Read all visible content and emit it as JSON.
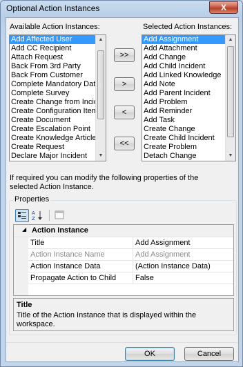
{
  "window": {
    "title": "Optional Action Instances",
    "close_glyph": "X"
  },
  "available": {
    "label": "Available Action Instances:",
    "items": [
      "Add Affected User",
      "Add CC Recipient",
      "Attach Request",
      "Back From 3rd Party",
      "Back From Customer",
      "Complete Mandatory Data",
      "Complete Survey",
      "Create Change from Incident",
      "Create Configuration Item",
      "Create Document",
      "Create Escalation Point",
      "Create Knowledge Article",
      "Create Request",
      "Declare Major Incident"
    ],
    "selected_index": 0
  },
  "selected": {
    "label": "Selected Action Instances:",
    "items": [
      "Add Assignment",
      "Add Attachment",
      "Add Change",
      "Add Child Incident",
      "Add Linked Knowledge",
      "Add Note",
      "Add Parent Incident",
      "Add Problem",
      "Add Reminder",
      "Add Task",
      "Create Change",
      "Create Child Incident",
      "Create Problem",
      "Detach Change"
    ],
    "selected_index": 0
  },
  "move_buttons": {
    "add_all": ">>",
    "add": ">",
    "remove": "<",
    "remove_all": "<<"
  },
  "info_text_line1": "If required you can modify the following properties of the",
  "info_text_line2": "selected Action Instance.",
  "properties": {
    "group_label": "Properties",
    "category_expander": "◢",
    "category": "Action Instance",
    "rows": [
      {
        "name": "Title",
        "value": "Add Assignment",
        "disabled": false
      },
      {
        "name": "Action Instance Name",
        "value": "Add Assignment",
        "disabled": true
      },
      {
        "name": "Action Instance Data",
        "value": "(Action Instance Data)",
        "disabled": false
      },
      {
        "name": "Propagate Action to Child",
        "value": "False",
        "disabled": false
      }
    ],
    "description_title": "Title",
    "description_line1": "Title of the Action Instance that is displayed within the",
    "description_line2": "workspace."
  },
  "buttons": {
    "ok": "OK",
    "cancel": "Cancel"
  },
  "colors": {
    "selection": "#3399ff",
    "frame": "#c3d5ea"
  },
  "icons": [
    "categorized-icon",
    "alphabetical-sort-icon",
    "property-pages-icon",
    "scroll-up-arrow-icon",
    "scroll-down-arrow-icon"
  ]
}
